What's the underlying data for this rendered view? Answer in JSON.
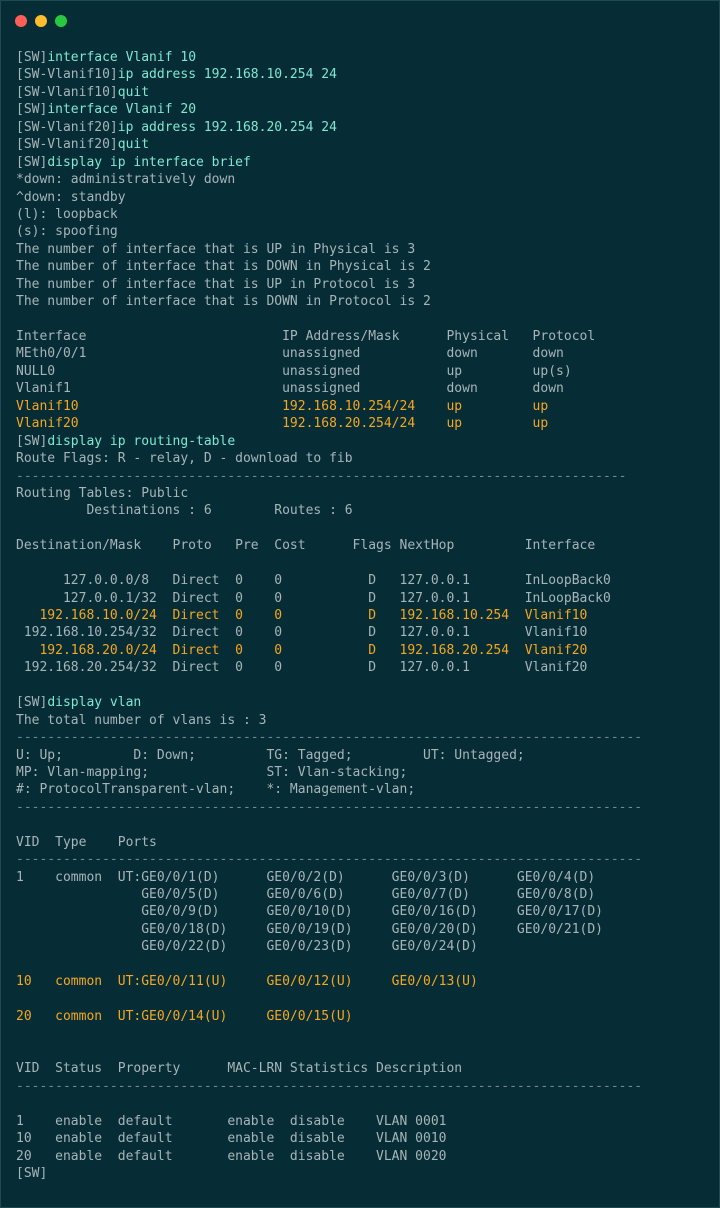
{
  "window": {
    "controls": [
      "close",
      "minimize",
      "maximize"
    ],
    "colors": {
      "background": "#062d36",
      "text": "#a7b4b8",
      "command": "#7ee8d2",
      "highlight": "#f5a623"
    }
  },
  "lines": [
    {
      "prompt": "[SW]",
      "cmd": "interface Vlanif 10"
    },
    {
      "prompt": "[SW-Vlanif10]",
      "cmd": "ip address 192.168.10.254 24"
    },
    {
      "prompt": "[SW-Vlanif10]",
      "cmd": "quit"
    },
    {
      "prompt": "[SW]",
      "cmd": "interface Vlanif 20"
    },
    {
      "prompt": "[SW-Vlanif20]",
      "cmd": "ip address 192.168.20.254 24"
    },
    {
      "prompt": "[SW-Vlanif20]",
      "cmd": "quit"
    },
    {
      "prompt": "[SW]",
      "cmd": "display ip interface brief"
    },
    {
      "text": "*down: administratively down"
    },
    {
      "text": "^down: standby"
    },
    {
      "text": "(l): loopback"
    },
    {
      "text": "(s): spoofing"
    },
    {
      "text": "The number of interface that is UP in Physical is 3"
    },
    {
      "text": "The number of interface that is DOWN in Physical is 2"
    },
    {
      "text": "The number of interface that is UP in Protocol is 3"
    },
    {
      "text": "The number of interface that is DOWN in Protocol is 2"
    },
    {
      "text": ""
    },
    {
      "text": "Interface                         IP Address/Mask      Physical   Protocol"
    },
    {
      "text": "MEth0/0/1                         unassigned           down       down"
    },
    {
      "text": "NULL0                             unassigned           up         up(s)"
    },
    {
      "text": "Vlanif1                           unassigned           down       down"
    },
    {
      "text": "Vlanif10                          192.168.10.254/24    up         up",
      "hl": true
    },
    {
      "text": "Vlanif20                          192.168.20.254/24    up         up",
      "hl": true
    },
    {
      "prompt": "[SW]",
      "cmd": "display ip routing-table"
    },
    {
      "text": "Route Flags: R - relay, D - download to fib"
    },
    {
      "text": "------------------------------------------------------------------------------",
      "dash": true
    },
    {
      "text": "Routing Tables: Public"
    },
    {
      "text": "         Destinations : 6        Routes : 6"
    },
    {
      "text": ""
    },
    {
      "text": "Destination/Mask    Proto   Pre  Cost      Flags NextHop         Interface"
    },
    {
      "text": ""
    },
    {
      "text": "      127.0.0.0/8   Direct  0    0           D   127.0.0.1       InLoopBack0"
    },
    {
      "text": "      127.0.0.1/32  Direct  0    0           D   127.0.0.1       InLoopBack0"
    },
    {
      "text": "   192.168.10.0/24  Direct  0    0           D   192.168.10.254  Vlanif10",
      "hl": true
    },
    {
      "text": " 192.168.10.254/32  Direct  0    0           D   127.0.0.1       Vlanif10"
    },
    {
      "text": "   192.168.20.0/24  Direct  0    0           D   192.168.20.254  Vlanif20",
      "hl": true
    },
    {
      "text": " 192.168.20.254/32  Direct  0    0           D   127.0.0.1       Vlanif20"
    },
    {
      "text": ""
    },
    {
      "prompt": "[SW]",
      "cmd": "display vlan"
    },
    {
      "text": "The total number of vlans is : 3"
    },
    {
      "text": "--------------------------------------------------------------------------------",
      "dash": true
    },
    {
      "text": "U: Up;         D: Down;         TG: Tagged;         UT: Untagged;"
    },
    {
      "text": "MP: Vlan-mapping;               ST: Vlan-stacking;"
    },
    {
      "text": "#: ProtocolTransparent-vlan;    *: Management-vlan;"
    },
    {
      "text": "--------------------------------------------------------------------------------",
      "dash": true
    },
    {
      "text": ""
    },
    {
      "text": "VID  Type    Ports"
    },
    {
      "text": "--------------------------------------------------------------------------------",
      "dash": true
    },
    {
      "text": "1    common  UT:GE0/0/1(D)      GE0/0/2(D)      GE0/0/3(D)      GE0/0/4(D)"
    },
    {
      "text": "                GE0/0/5(D)      GE0/0/6(D)      GE0/0/7(D)      GE0/0/8(D)"
    },
    {
      "text": "                GE0/0/9(D)      GE0/0/10(D)     GE0/0/16(D)     GE0/0/17(D)"
    },
    {
      "text": "                GE0/0/18(D)     GE0/0/19(D)     GE0/0/20(D)     GE0/0/21(D)"
    },
    {
      "text": "                GE0/0/22(D)     GE0/0/23(D)     GE0/0/24(D)"
    },
    {
      "text": ""
    },
    {
      "text": "10   common  UT:GE0/0/11(U)     GE0/0/12(U)     GE0/0/13(U)",
      "hl": true
    },
    {
      "text": ""
    },
    {
      "text": "20   common  UT:GE0/0/14(U)     GE0/0/15(U)",
      "hl": true
    },
    {
      "text": ""
    },
    {
      "text": ""
    },
    {
      "text": "VID  Status  Property      MAC-LRN Statistics Description"
    },
    {
      "text": "--------------------------------------------------------------------------------",
      "dash": true
    },
    {
      "text": ""
    },
    {
      "text": "1    enable  default       enable  disable    VLAN 0001"
    },
    {
      "text": "10   enable  default       enable  disable    VLAN 0010"
    },
    {
      "text": "20   enable  default       enable  disable    VLAN 0020"
    },
    {
      "prompt": "[SW]",
      "cmd": ""
    }
  ]
}
